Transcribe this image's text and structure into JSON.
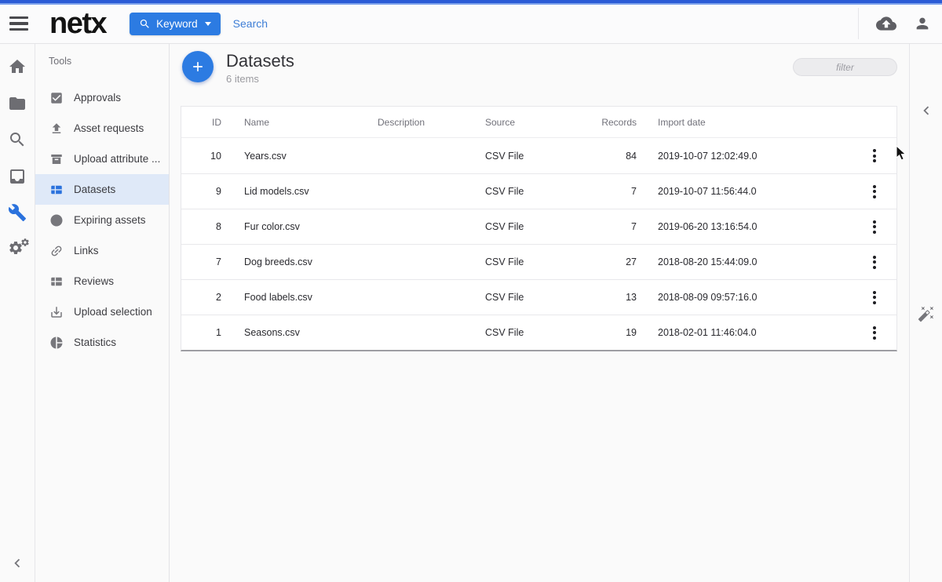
{
  "topbar": {
    "logo_text": "netx",
    "keyword_button_label": "Keyword",
    "search_placeholder": "Search"
  },
  "sidebar": {
    "section_title": "Tools",
    "items": [
      {
        "label": "Approvals",
        "icon": "checkbox-icon"
      },
      {
        "label": "Asset requests",
        "icon": "upload-icon"
      },
      {
        "label": "Upload attribute ...",
        "icon": "archive-icon"
      },
      {
        "label": "Datasets",
        "icon": "table-icon",
        "active": true
      },
      {
        "label": "Expiring assets",
        "icon": "clock-icon"
      },
      {
        "label": "Links",
        "icon": "link-icon"
      },
      {
        "label": "Reviews",
        "icon": "grid-icon"
      },
      {
        "label": "Upload selection",
        "icon": "download-icon"
      },
      {
        "label": "Statistics",
        "icon": "pie-chart-icon"
      }
    ]
  },
  "main": {
    "page_title": "Datasets",
    "item_count": "6 items",
    "filter_placeholder": "filter",
    "table": {
      "columns": [
        "ID",
        "Name",
        "Description",
        "Source",
        "Records",
        "Import date"
      ],
      "rows": [
        {
          "id": "10",
          "name": "Years.csv",
          "description": "",
          "source": "CSV File",
          "records": "84",
          "import_date": "2019-10-07 12:02:49.0"
        },
        {
          "id": "9",
          "name": "Lid models.csv",
          "description": "",
          "source": "CSV File",
          "records": "7",
          "import_date": "2019-10-07 11:56:44.0"
        },
        {
          "id": "8",
          "name": "Fur color.csv",
          "description": "",
          "source": "CSV File",
          "records": "7",
          "import_date": "2019-06-20 13:16:54.0"
        },
        {
          "id": "7",
          "name": "Dog breeds.csv",
          "description": "",
          "source": "CSV File",
          "records": "27",
          "import_date": "2018-08-20 15:44:09.0"
        },
        {
          "id": "2",
          "name": "Food labels.csv",
          "description": "",
          "source": "CSV File",
          "records": "13",
          "import_date": "2018-08-09 09:57:16.0"
        },
        {
          "id": "1",
          "name": "Seasons.csv",
          "description": "",
          "source": "CSV File",
          "records": "19",
          "import_date": "2018-02-01 11:46:04.0"
        }
      ]
    }
  },
  "colors": {
    "accent_blue": "#2b72dd",
    "button_blue": "#2c7be2",
    "link_blue": "#3d7ed6",
    "top_strip_dark": "#2a5bd6",
    "top_strip_light": "#7fa3ec",
    "selected_item_bg": "#dfe9f8"
  }
}
